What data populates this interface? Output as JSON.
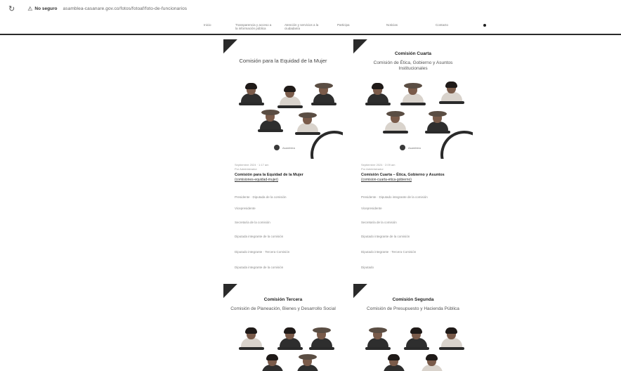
{
  "browser": {
    "reload_icon": "↻",
    "warning_icon": "⚠",
    "security_label": "No seguro",
    "url": "asamblea-casanare.gov.co/fotos/fotoaf/foto-de-funcionarios"
  },
  "nav": {
    "items": [
      {
        "label": "Inicio"
      },
      {
        "label": "Transparencia y acceso a la información pública"
      },
      {
        "label": "Atención y servicios a la ciudadanía"
      },
      {
        "label": "Participa"
      },
      {
        "label": "Noticias"
      },
      {
        "label": "Contacto"
      }
    ]
  },
  "posters": [
    {
      "title": "Comisión para la Equidad de la Mujer",
      "subtitle": "",
      "logo_text": "Asamblea"
    },
    {
      "title": "Comisión Cuarta",
      "subtitle": "Comisión de Ética, Gobierno y Asuntos Institucionales",
      "logo_text": "Asamblea"
    },
    {
      "title": "Comisión Tercera",
      "subtitle": "Comisión de Planeación, Bienes y Desarrollo Social",
      "logo_text": ""
    },
    {
      "title": "Comisión Segunda",
      "subtitle": "Comisión de Presupuesto y Hacienda Pública",
      "logo_text": ""
    }
  ],
  "posts": [
    {
      "meta_date": "Septiembre 2024 · 1:17 am",
      "meta_author": "Por Administrador",
      "title": "Comisión para la Equidad de la Mujer",
      "link": "(comisiones-equidad-mujer)",
      "rows": [
        "Presidente · Diputada de la comisión",
        "Vicepresidente",
        "Secretaría de la comisión",
        "Diputada integrante de la comisión",
        "Diputado integrante · Tercera Comisión",
        "Diputada integrante de la comisión"
      ]
    },
    {
      "meta_date": "Septiembre 2024 · 2:09 am",
      "meta_author": "Por Administrador",
      "title": "Comisión Cuarta – Ética, Gobierno y Asuntos",
      "link": "(comision-cuarta-etica-gobierno)",
      "rows": [
        "Presidente · Diputado integrante de la comisión",
        "Vicepresidente",
        "Secretaría de la comisión",
        "Diputado integrante de la comisión",
        "Diputado integrante · Tercera Comisión",
        "Diputado"
      ]
    }
  ]
}
